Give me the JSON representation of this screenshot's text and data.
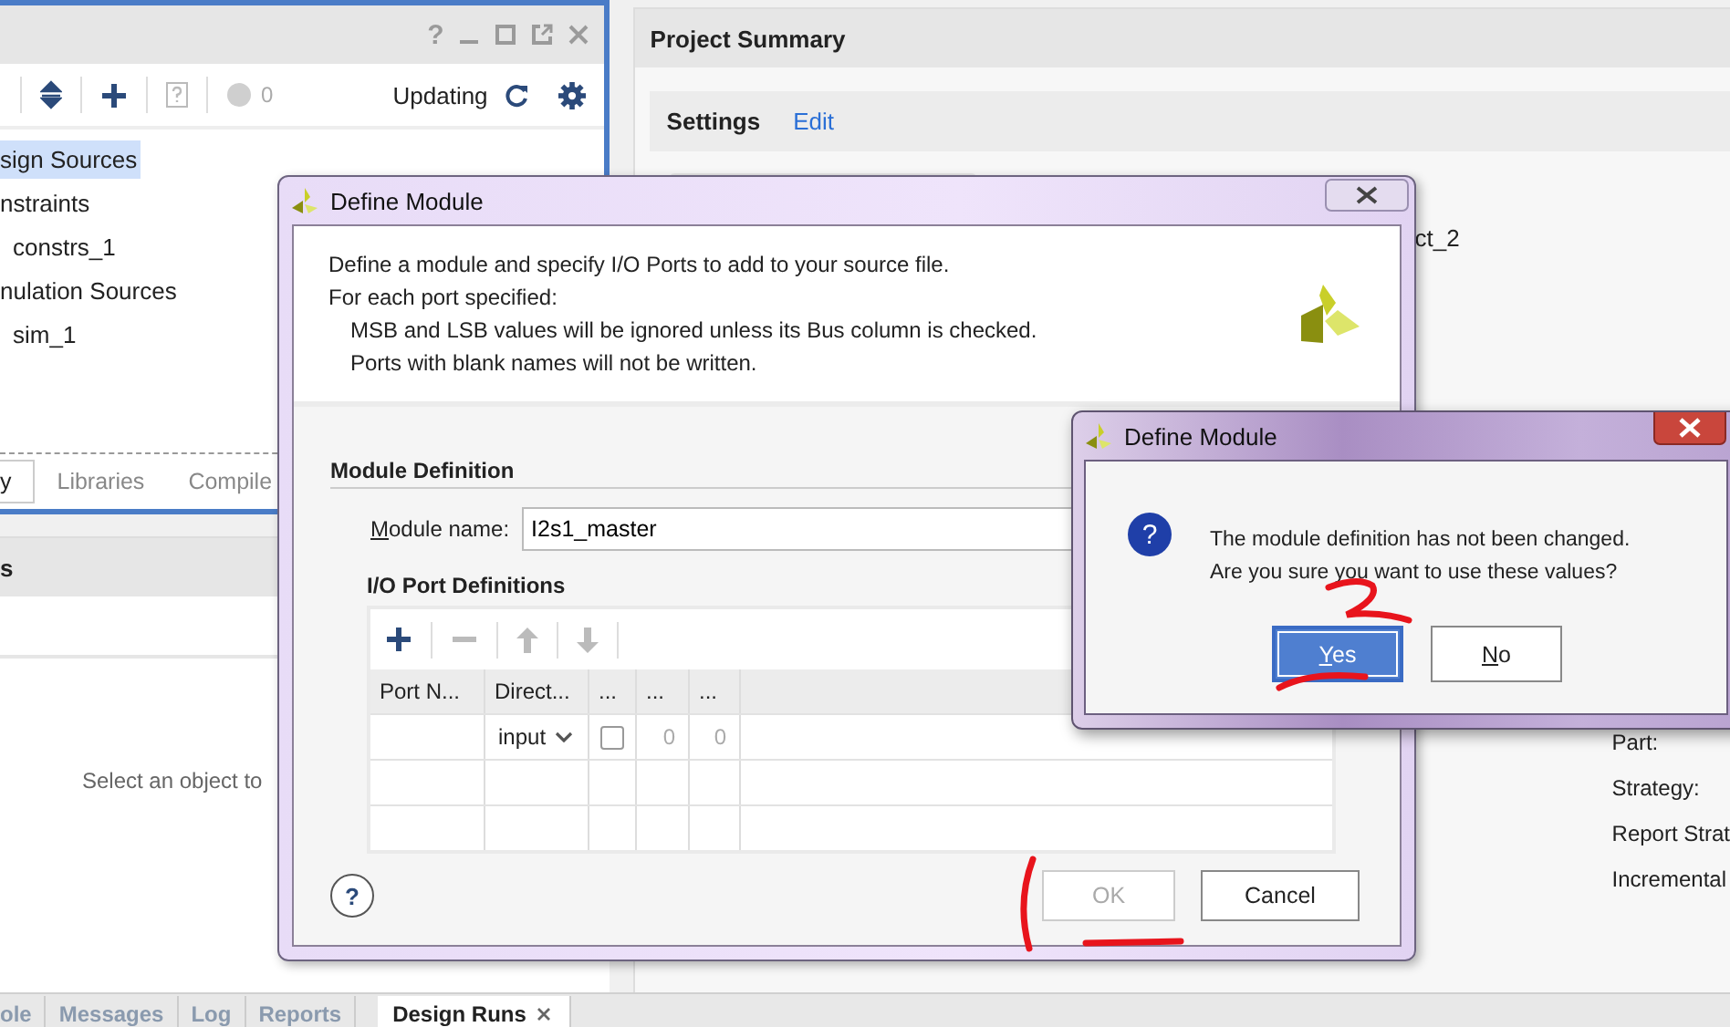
{
  "sources_panel": {
    "help_glyph": "?",
    "toolbar": {
      "issue_count": "0",
      "status": "Updating"
    },
    "tree": [
      {
        "label": "sign Sources",
        "selected": true
      },
      {
        "label": "nstraints",
        "selected": false,
        "children": [
          {
            "label": "constrs_1",
            "selected": false
          }
        ]
      },
      {
        "label": "nulation Sources",
        "selected": false,
        "children": [
          {
            "label": "sim_1",
            "selected": false
          }
        ]
      }
    ],
    "tabs": [
      {
        "label": "y",
        "selected": true
      },
      {
        "label": "Libraries",
        "selected": false
      },
      {
        "label": "Compile",
        "selected": false
      }
    ]
  },
  "properties_panel": {
    "title": "s",
    "hint": "Select an object to"
  },
  "project_summary": {
    "title": "Project Summary",
    "settings_title": "Settings",
    "edit_link": "Edit",
    "project_value": "ct_2",
    "labels": [
      "Part:",
      "Strategy:",
      "Report Strat",
      "Incremental"
    ]
  },
  "bottom_tabs": [
    {
      "label": "ole",
      "selected": false
    },
    {
      "label": "Messages",
      "selected": false
    },
    {
      "label": "Log",
      "selected": false
    },
    {
      "label": "Reports",
      "selected": false
    },
    {
      "label": "Design Runs",
      "selected": true
    }
  ],
  "define_module_dialog": {
    "title": "Define Module",
    "intro": [
      "Define a module and specify I/O Ports to add to your source file.",
      "For each port specified:"
    ],
    "notes": [
      "MSB and LSB values will be ignored unless its Bus column is checked.",
      "Ports with blank names will not be written."
    ],
    "section_title": "Module Definition",
    "module_name_label": "Module name:",
    "module_name_value": "I2s1_master",
    "ports_title": "I/O Port Definitions",
    "columns": [
      "Port N...",
      "Direct...",
      "...",
      "...",
      "..."
    ],
    "rows": [
      {
        "kind": "port",
        "direction": "input",
        "bus_checked": false,
        "msb": "0",
        "lsb": "0"
      },
      {
        "kind": "blank"
      },
      {
        "kind": "blank"
      }
    ],
    "help_glyph": "?",
    "buttons": [
      {
        "label": "OK",
        "disabled": true
      },
      {
        "label": "Cancel",
        "disabled": false
      }
    ]
  },
  "confirm_dialog": {
    "title": "Define Module",
    "icon_glyph": "?",
    "message": [
      "The module definition has not been changed.",
      "Are you sure you want to use these values?"
    ],
    "buttons": [
      {
        "label": "Yes",
        "selected": true
      },
      {
        "label": "No",
        "selected": false
      }
    ]
  }
}
